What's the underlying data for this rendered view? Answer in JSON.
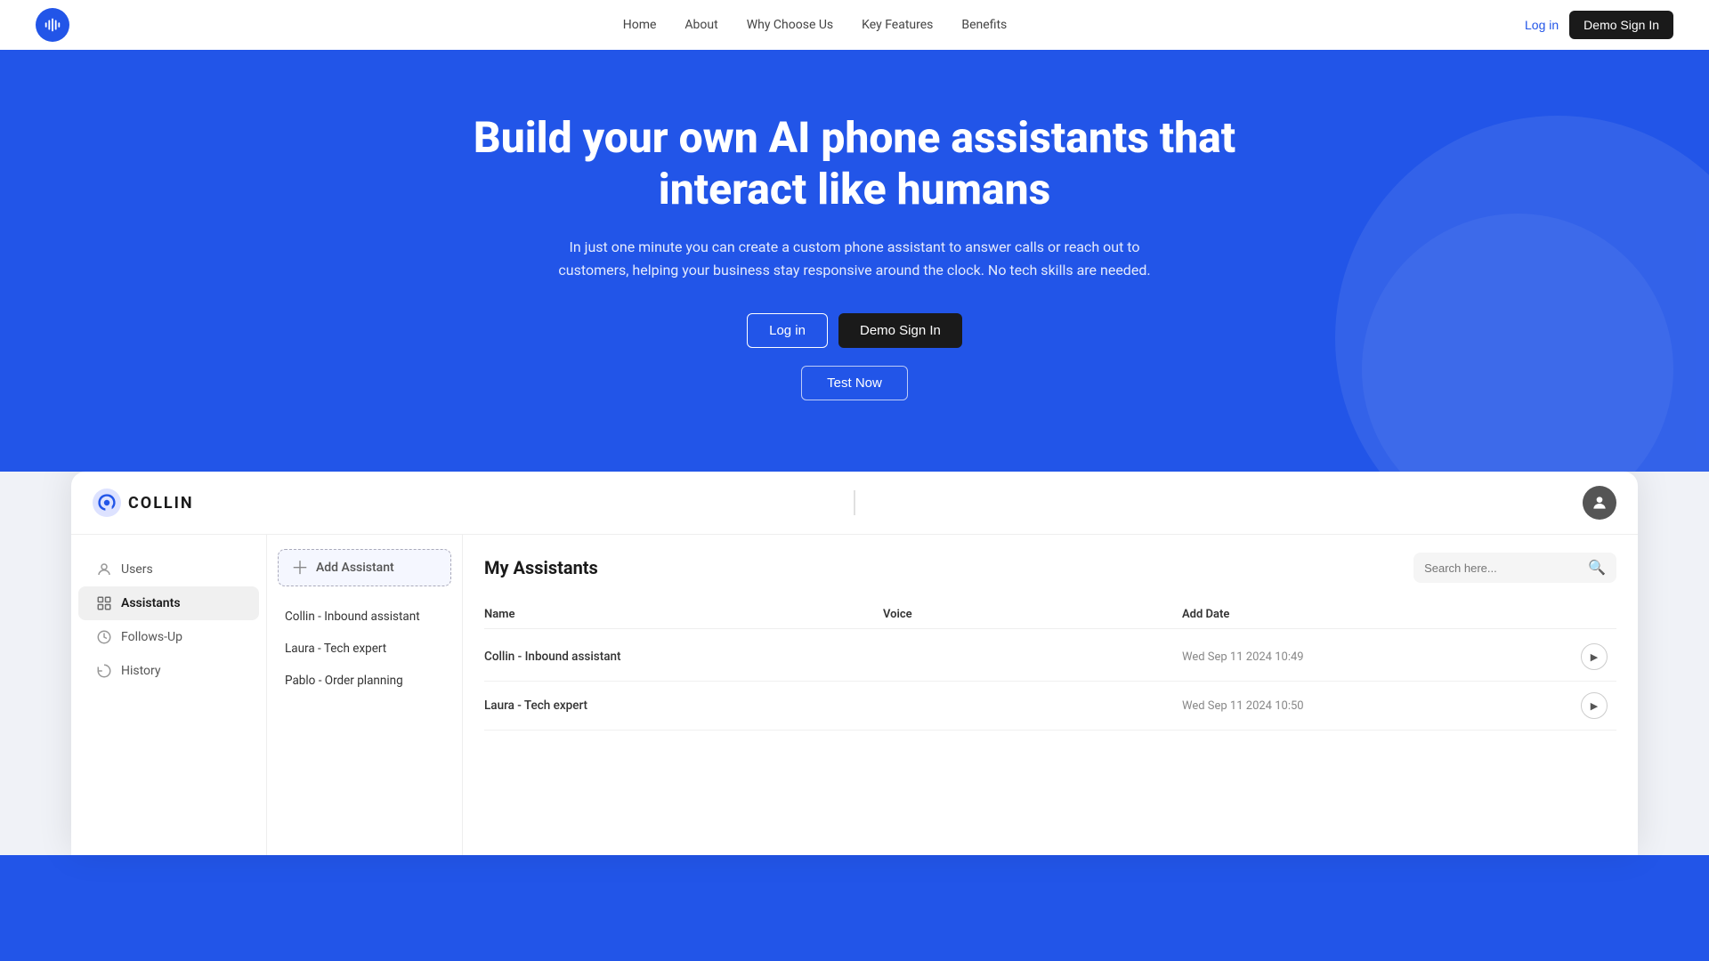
{
  "navbar": {
    "links": [
      "Home",
      "About",
      "Why Choose Us",
      "Key Features",
      "Benefits"
    ],
    "login_label": "Log in",
    "demo_label": "Demo Sign In"
  },
  "hero": {
    "headline": "Build your own AI phone assistants that interact like humans",
    "subtext": "In just one minute you can create a custom phone assistant to answer calls or reach out to customers, helping your business stay responsive around the clock. No tech skills are needed.",
    "login_btn": "Log in",
    "demo_btn": "Demo Sign In",
    "test_btn": "Test Now"
  },
  "dashboard": {
    "brand": "COLLIN",
    "sidebar": {
      "items": [
        {
          "label": "Users",
          "icon": "user-icon"
        },
        {
          "label": "Assistants",
          "icon": "assistants-icon",
          "active": true
        },
        {
          "label": "Follows-Up",
          "icon": "followup-icon"
        },
        {
          "label": "History",
          "icon": "history-icon"
        }
      ]
    },
    "assistant_list": {
      "add_label": "Add Assistant",
      "items": [
        {
          "label": "Collin - Inbound assistant"
        },
        {
          "label": "Laura - Tech expert"
        },
        {
          "label": "Pablo - Order planning"
        }
      ]
    },
    "my_assistants": {
      "title": "My Assistants",
      "search_placeholder": "Search here...",
      "columns": [
        "Name",
        "Voice",
        "Add Date"
      ],
      "rows": [
        {
          "name": "Collin - Inbound assistant",
          "voice": "",
          "date": "Wed Sep 11 2024  10:49"
        },
        {
          "name": "Laura - Tech expert",
          "voice": "",
          "date": "Wed Sep 11 2024  10:50"
        }
      ]
    }
  }
}
